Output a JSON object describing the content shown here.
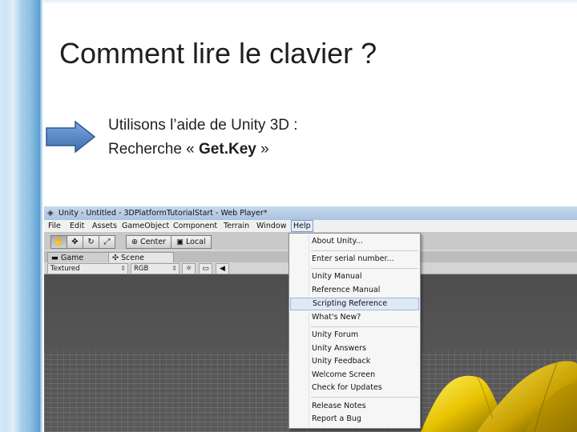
{
  "slide": {
    "title": "Comment lire le clavier ?",
    "line1": "Utilisons l’aide de Unity 3D :",
    "line2_prefix": "Recherche « ",
    "line2_bold": "Get.Key",
    "line2_suffix": " »",
    "arrow_icon": "right-arrow-icon",
    "accent_color": "#4f81bd"
  },
  "unity": {
    "window_title": "Unity - Untitled - 3DPlatformTutorialStart - Web Player*",
    "menu": [
      "File",
      "Edit",
      "Assets",
      "GameObject",
      "Component",
      "Terrain",
      "Window",
      "Help"
    ],
    "toolbar": {
      "hand_icon": "hand-icon",
      "move_icon": "move-icon",
      "rotate_icon": "rotate-icon",
      "scale_icon": "scale-icon",
      "pivot_label": "Center",
      "space_label": "Local"
    },
    "tabs": [
      "Game",
      "Scene"
    ],
    "scene_options": {
      "draw_mode": "Textured",
      "render_mode": "RGB"
    },
    "help_menu": [
      "About Unity...",
      "Enter serial number...",
      "Unity Manual",
      "Reference Manual",
      "Scripting Reference",
      "What's New?",
      "Unity Forum",
      "Unity Answers",
      "Unity Feedback",
      "Welcome Screen",
      "Check for Updates",
      "Release Notes",
      "Report a Bug"
    ],
    "highlighted_item": "Scripting Reference"
  }
}
